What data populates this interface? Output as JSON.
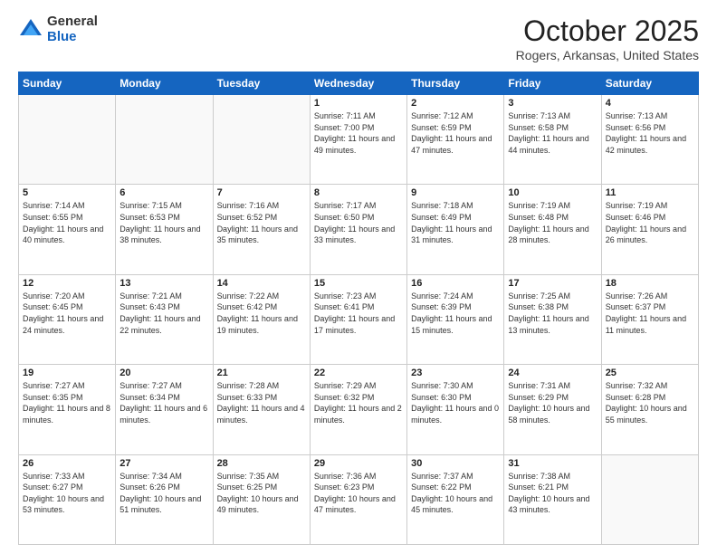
{
  "logo": {
    "general": "General",
    "blue": "Blue"
  },
  "title": "October 2025",
  "location": "Rogers, Arkansas, United States",
  "days_of_week": [
    "Sunday",
    "Monday",
    "Tuesday",
    "Wednesday",
    "Thursday",
    "Friday",
    "Saturday"
  ],
  "weeks": [
    [
      {
        "day": "",
        "info": ""
      },
      {
        "day": "",
        "info": ""
      },
      {
        "day": "",
        "info": ""
      },
      {
        "day": "1",
        "info": "Sunrise: 7:11 AM\nSunset: 7:00 PM\nDaylight: 11 hours and 49 minutes."
      },
      {
        "day": "2",
        "info": "Sunrise: 7:12 AM\nSunset: 6:59 PM\nDaylight: 11 hours and 47 minutes."
      },
      {
        "day": "3",
        "info": "Sunrise: 7:13 AM\nSunset: 6:58 PM\nDaylight: 11 hours and 44 minutes."
      },
      {
        "day": "4",
        "info": "Sunrise: 7:13 AM\nSunset: 6:56 PM\nDaylight: 11 hours and 42 minutes."
      }
    ],
    [
      {
        "day": "5",
        "info": "Sunrise: 7:14 AM\nSunset: 6:55 PM\nDaylight: 11 hours and 40 minutes."
      },
      {
        "day": "6",
        "info": "Sunrise: 7:15 AM\nSunset: 6:53 PM\nDaylight: 11 hours and 38 minutes."
      },
      {
        "day": "7",
        "info": "Sunrise: 7:16 AM\nSunset: 6:52 PM\nDaylight: 11 hours and 35 minutes."
      },
      {
        "day": "8",
        "info": "Sunrise: 7:17 AM\nSunset: 6:50 PM\nDaylight: 11 hours and 33 minutes."
      },
      {
        "day": "9",
        "info": "Sunrise: 7:18 AM\nSunset: 6:49 PM\nDaylight: 11 hours and 31 minutes."
      },
      {
        "day": "10",
        "info": "Sunrise: 7:19 AM\nSunset: 6:48 PM\nDaylight: 11 hours and 28 minutes."
      },
      {
        "day": "11",
        "info": "Sunrise: 7:19 AM\nSunset: 6:46 PM\nDaylight: 11 hours and 26 minutes."
      }
    ],
    [
      {
        "day": "12",
        "info": "Sunrise: 7:20 AM\nSunset: 6:45 PM\nDaylight: 11 hours and 24 minutes."
      },
      {
        "day": "13",
        "info": "Sunrise: 7:21 AM\nSunset: 6:43 PM\nDaylight: 11 hours and 22 minutes."
      },
      {
        "day": "14",
        "info": "Sunrise: 7:22 AM\nSunset: 6:42 PM\nDaylight: 11 hours and 19 minutes."
      },
      {
        "day": "15",
        "info": "Sunrise: 7:23 AM\nSunset: 6:41 PM\nDaylight: 11 hours and 17 minutes."
      },
      {
        "day": "16",
        "info": "Sunrise: 7:24 AM\nSunset: 6:39 PM\nDaylight: 11 hours and 15 minutes."
      },
      {
        "day": "17",
        "info": "Sunrise: 7:25 AM\nSunset: 6:38 PM\nDaylight: 11 hours and 13 minutes."
      },
      {
        "day": "18",
        "info": "Sunrise: 7:26 AM\nSunset: 6:37 PM\nDaylight: 11 hours and 11 minutes."
      }
    ],
    [
      {
        "day": "19",
        "info": "Sunrise: 7:27 AM\nSunset: 6:35 PM\nDaylight: 11 hours and 8 minutes."
      },
      {
        "day": "20",
        "info": "Sunrise: 7:27 AM\nSunset: 6:34 PM\nDaylight: 11 hours and 6 minutes."
      },
      {
        "day": "21",
        "info": "Sunrise: 7:28 AM\nSunset: 6:33 PM\nDaylight: 11 hours and 4 minutes."
      },
      {
        "day": "22",
        "info": "Sunrise: 7:29 AM\nSunset: 6:32 PM\nDaylight: 11 hours and 2 minutes."
      },
      {
        "day": "23",
        "info": "Sunrise: 7:30 AM\nSunset: 6:30 PM\nDaylight: 11 hours and 0 minutes."
      },
      {
        "day": "24",
        "info": "Sunrise: 7:31 AM\nSunset: 6:29 PM\nDaylight: 10 hours and 58 minutes."
      },
      {
        "day": "25",
        "info": "Sunrise: 7:32 AM\nSunset: 6:28 PM\nDaylight: 10 hours and 55 minutes."
      }
    ],
    [
      {
        "day": "26",
        "info": "Sunrise: 7:33 AM\nSunset: 6:27 PM\nDaylight: 10 hours and 53 minutes."
      },
      {
        "day": "27",
        "info": "Sunrise: 7:34 AM\nSunset: 6:26 PM\nDaylight: 10 hours and 51 minutes."
      },
      {
        "day": "28",
        "info": "Sunrise: 7:35 AM\nSunset: 6:25 PM\nDaylight: 10 hours and 49 minutes."
      },
      {
        "day": "29",
        "info": "Sunrise: 7:36 AM\nSunset: 6:23 PM\nDaylight: 10 hours and 47 minutes."
      },
      {
        "day": "30",
        "info": "Sunrise: 7:37 AM\nSunset: 6:22 PM\nDaylight: 10 hours and 45 minutes."
      },
      {
        "day": "31",
        "info": "Sunrise: 7:38 AM\nSunset: 6:21 PM\nDaylight: 10 hours and 43 minutes."
      },
      {
        "day": "",
        "info": ""
      }
    ]
  ]
}
